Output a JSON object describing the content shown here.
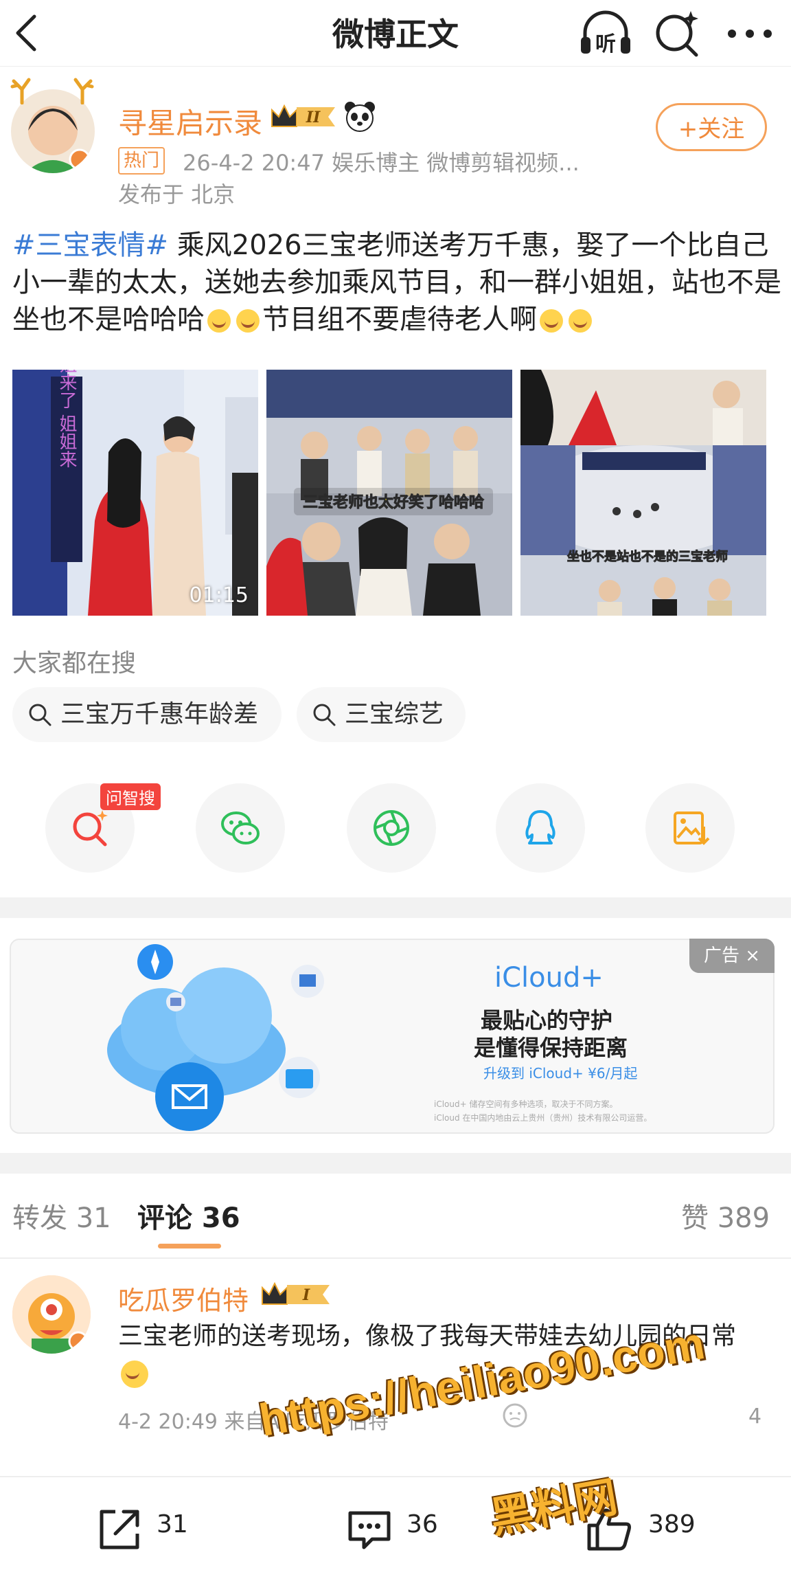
{
  "header": {
    "title": "微博正文",
    "listen_label": "听"
  },
  "author": {
    "name": "寻星启示录",
    "level": "II",
    "hot_badge": "热门",
    "meta": "26-4-2 20:47  娱乐博主 微博剪辑视频...",
    "location": "发布于 北京",
    "follow_label": "+关注"
  },
  "post": {
    "topic": "#三宝表情#",
    "text_1": " 乘风2026三宝老师送考万千惠，娶了一个比自己小一辈的太太，送她去参加乘风节目，和一群小姐姐，站也不是坐也不是哈哈哈",
    "text_2": "节目组不要虐待老人啊",
    "emoji": "laughing-crying-emoji"
  },
  "images": {
    "img1_caption": "姐姐来了 姐姐来",
    "video_duration": "01:15",
    "img2_caption": "三宝老师也太好笑了哈哈哈",
    "img3_caption": "坐也不是站也不是的三宝老师"
  },
  "hot_search": {
    "title": "大家都在搜",
    "chips": [
      "三宝万千惠年龄差",
      "三宝综艺"
    ]
  },
  "share": {
    "zhisou_tag": "问智搜"
  },
  "ad": {
    "tag": "广告 ×",
    "brand": "iCloud+",
    "line1": "最贴心的守护",
    "line2": "是懂得保持距离",
    "cta": "升级到 iCloud+ ¥6/月起",
    "fine1": "iCloud+ 储存空间有多种选项，取决于不同方案。",
    "fine2": "iCloud 在中国内地由云上贵州（贵州）技术有限公司运营。"
  },
  "tabs": {
    "repost": "转发 31",
    "comment": "评论 36",
    "like": "赞 389"
  },
  "comment": {
    "name": "吃瓜罗伯特",
    "level": "I",
    "text": "三宝老师的送考现场，像极了我每天带娃去幼儿园的日常",
    "meta": "4-2 20:49 来自AI吃瓜罗伯特",
    "like_count": "4"
  },
  "bottom": {
    "repost_count": "31",
    "comment_count": "36",
    "like_count": "389"
  },
  "watermark": {
    "url": "https://heiliao90.com",
    "name": "黑料网"
  },
  "colors": {
    "accent_orange": "#f08a3c",
    "topic_blue": "#3a7bd5",
    "alert_red": "#f3443d"
  }
}
